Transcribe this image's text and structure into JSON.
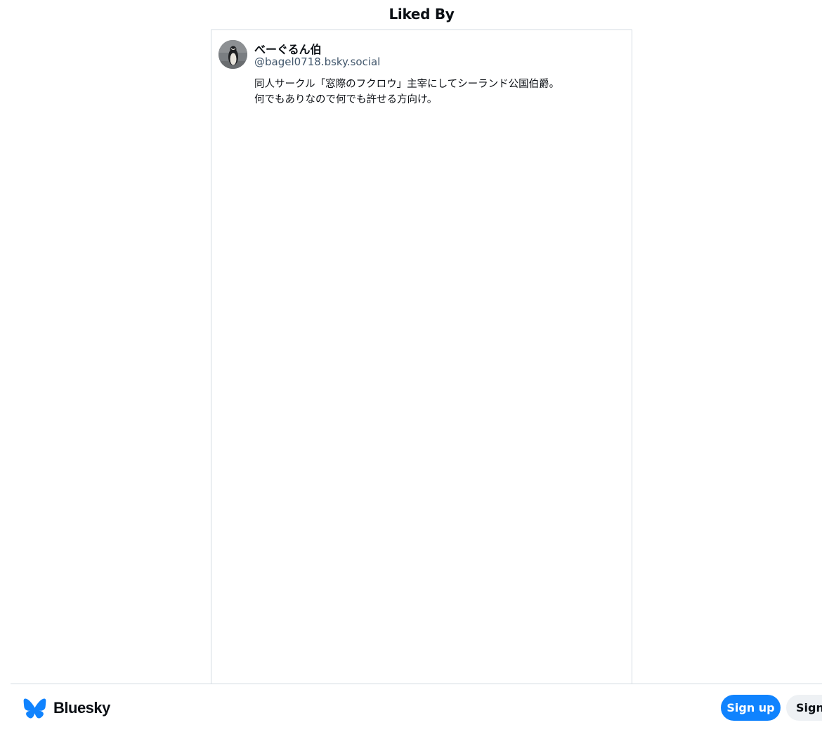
{
  "header": {
    "title": "Liked By"
  },
  "likes": [
    {
      "display_name": "べーぐるん伯",
      "handle": "@bagel0718.bsky.social",
      "bio_lines": [
        "同人サークル「窓際のフクロウ」主宰にしてシーランド公国伯爵。",
        "何でもありなので何でも許せる方向け。"
      ],
      "avatar_icon": "penguin-avatar"
    }
  ],
  "footer": {
    "brand": "Bluesky",
    "brand_icon": "butterfly-icon",
    "signup_label": "Sign up",
    "signin_label": "Sign in"
  },
  "colors": {
    "accent": "#1083fe",
    "border": "#d4dbe2",
    "handle": "#42576c"
  }
}
